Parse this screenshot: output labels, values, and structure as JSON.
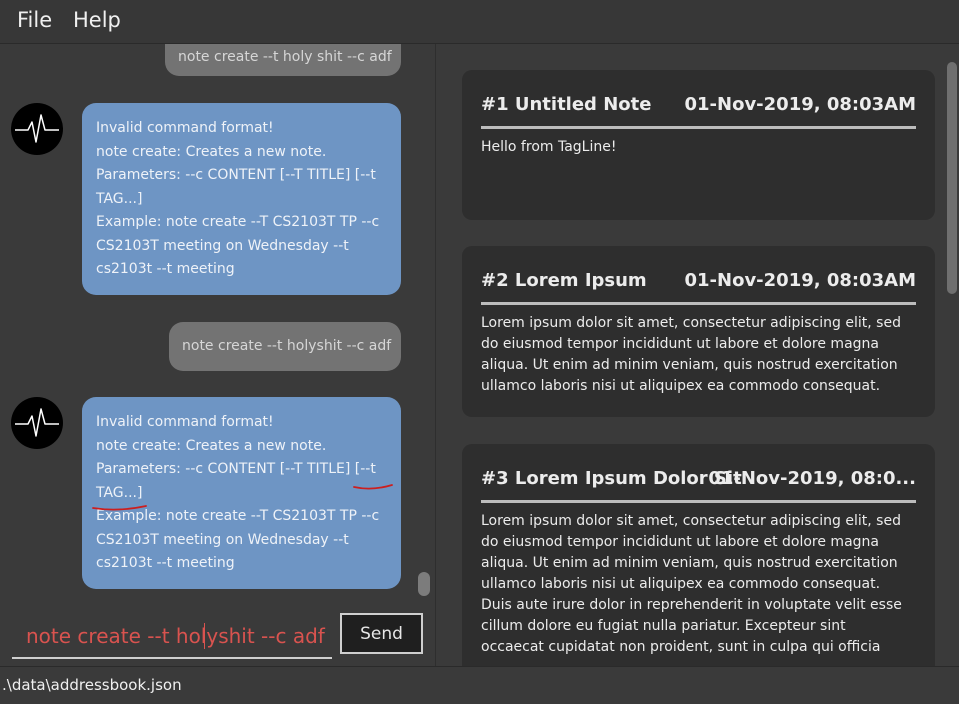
{
  "menu": {
    "file": "File",
    "help": "Help"
  },
  "chat": {
    "user_message_1": "note create --t holy shit --c adf",
    "bot_reply_1": [
      "Invalid command format!",
      "note create: Creates a new note.",
      "Parameters: --c CONTENT [--T TITLE] [--t",
      "TAG...]",
      "Example: note create --T CS2103T TP --c",
      "CS2103T meeting on Wednesday --t",
      "cs2103t --t meeting"
    ],
    "user_message_2": "note create --t holyshit --c adf",
    "bot_reply_2": [
      "Invalid command format!",
      "note create: Creates a new note.",
      "Parameters: --c CONTENT [--T TITLE] [--t",
      "TAG...]",
      "Example: note create --T CS2103T TP --c",
      "CS2103T meeting on Wednesday --t",
      "cs2103t --t meeting"
    ]
  },
  "input": {
    "value": "note create --t holyshit --c adf",
    "send_label": "Send"
  },
  "notes": [
    {
      "title": "#1 Untitled Note",
      "date": "01-Nov-2019, 08:03AM",
      "body": [
        "Hello from TagLine!"
      ]
    },
    {
      "title": "#2 Lorem Ipsum",
      "date": "01-Nov-2019, 08:03AM",
      "body": [
        "Lorem ipsum dolor sit amet, consectetur adipiscing elit, sed",
        "do eiusmod tempor incididunt ut labore et dolore magna",
        "aliqua. Ut enim ad minim veniam, quis nostrud exercitation",
        "ullamco laboris nisi ut aliquipex ea commodo consequat."
      ]
    },
    {
      "title": "#3 Lorem Ipsum Dolor Sit",
      "date": "01-Nov-2019, 08:0...",
      "body": [
        "Lorem ipsum dolor sit amet, consectetur adipiscing elit, sed",
        "do eiusmod tempor incididunt ut labore et dolore magna",
        "aliqua. Ut enim ad minim veniam, quis nostrud exercitation",
        "ullamco laboris nisi ut aliquipex ea commodo consequat.",
        "Duis aute irure dolor in reprehenderit in voluptate velit esse",
        "cillum dolore eu fugiat nulla pariatur. Excepteur sint",
        "occaecat cupidatat non proident, sunt in culpa qui officia"
      ]
    }
  ],
  "status": {
    "path": ".\\data\\addressbook.json"
  },
  "colors": {
    "bot_bubble": "#6e95c4",
    "user_bubble": "#737373",
    "input_text": "#d9534f",
    "annotation": "#cc1f1f"
  }
}
